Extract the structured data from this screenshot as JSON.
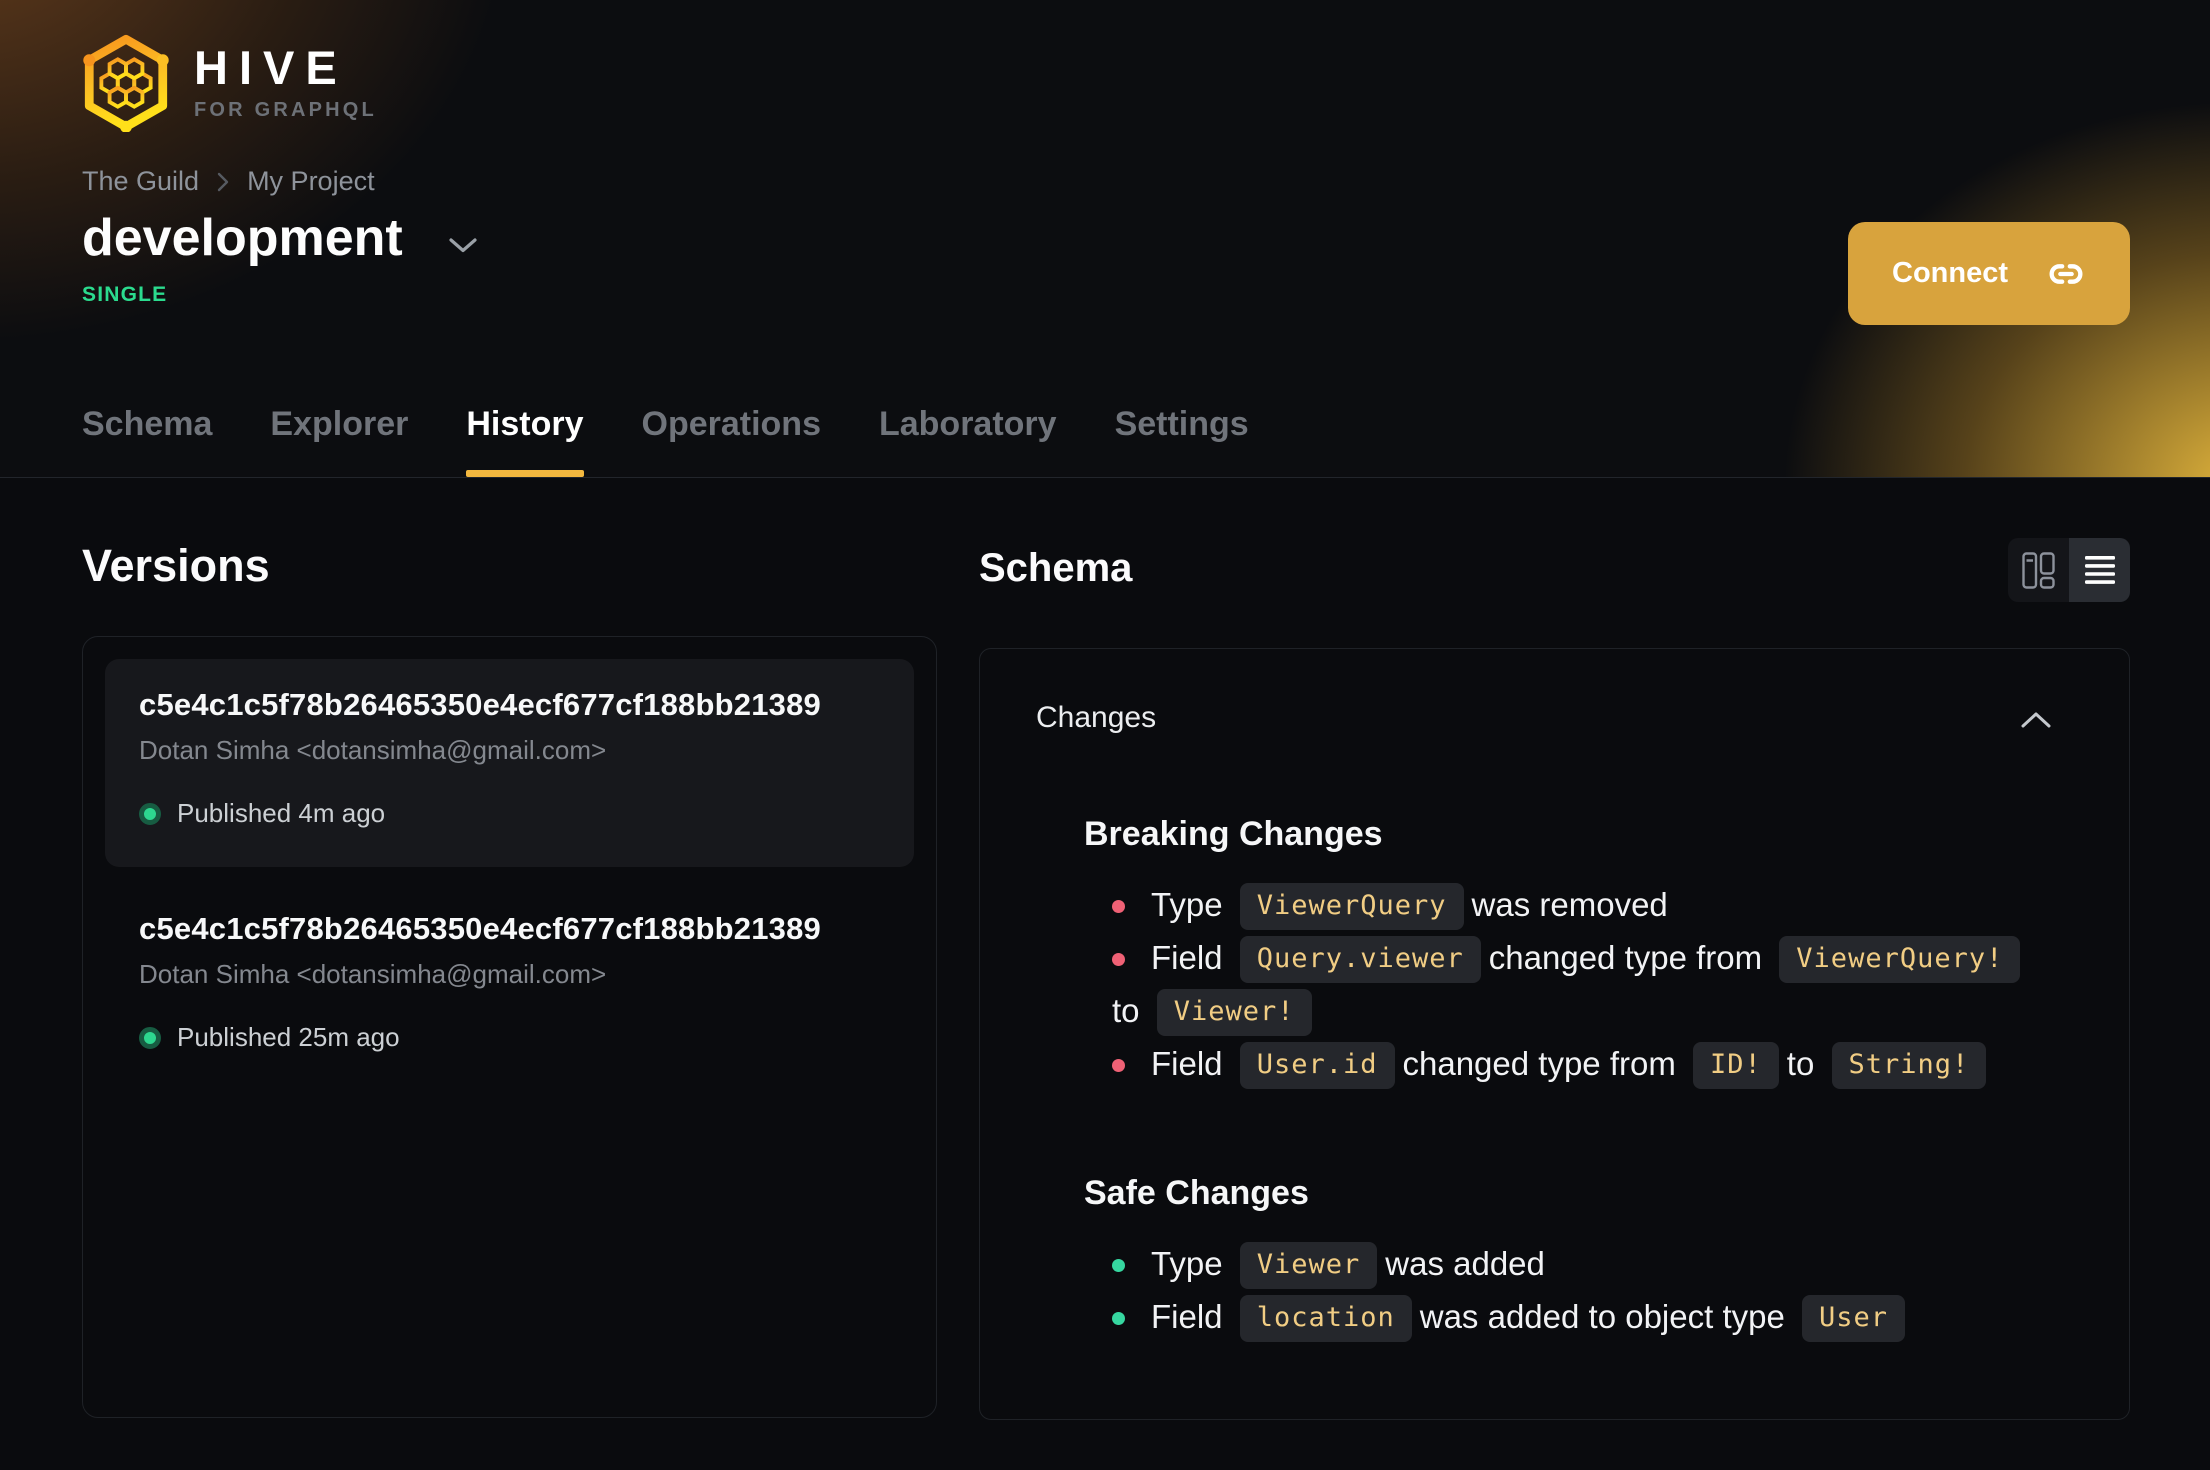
{
  "brand": {
    "name": "HIVE",
    "tagline": "FOR GRAPHQL"
  },
  "breadcrumb": {
    "items": [
      "The Guild",
      "My Project"
    ]
  },
  "target": {
    "title": "development",
    "badge": "SINGLE"
  },
  "connect": {
    "label": "Connect"
  },
  "tabs": [
    {
      "label": "Schema",
      "active": false
    },
    {
      "label": "Explorer",
      "active": false
    },
    {
      "label": "History",
      "active": true
    },
    {
      "label": "Operations",
      "active": false
    },
    {
      "label": "Laboratory",
      "active": false
    },
    {
      "label": "Settings",
      "active": false
    }
  ],
  "versions": {
    "heading": "Versions",
    "items": [
      {
        "hash": "c5e4c1c5f78b26465350e4ecf677cf188bb21389",
        "author": "Dotan Simha <dotansimha@gmail.com>",
        "status": "Published 4m ago",
        "selected": true
      },
      {
        "hash": "c5e4c1c5f78b26465350e4ecf677cf188bb21389",
        "author": "Dotan Simha <dotansimha@gmail.com>",
        "status": "Published 25m ago",
        "selected": false
      }
    ]
  },
  "schema": {
    "heading": "Schema",
    "panel_title": "Changes",
    "view_toggle": {
      "options": [
        "split-view",
        "list-view"
      ],
      "active": "list-view"
    },
    "sections": [
      {
        "title": "Breaking Changes",
        "severity": "breaking",
        "items": [
          {
            "parts": [
              {
                "t": "text",
                "v": "Type"
              },
              {
                "t": "code",
                "v": "ViewerQuery"
              },
              {
                "t": "text",
                "v": "was removed"
              }
            ]
          },
          {
            "parts": [
              {
                "t": "text",
                "v": "Field"
              },
              {
                "t": "code",
                "v": "Query.viewer"
              },
              {
                "t": "text",
                "v": "changed type from"
              },
              {
                "t": "code",
                "v": "ViewerQuery!"
              },
              {
                "t": "break"
              },
              {
                "t": "text",
                "v": "to"
              },
              {
                "t": "code",
                "v": "Viewer!"
              }
            ]
          },
          {
            "parts": [
              {
                "t": "text",
                "v": "Field"
              },
              {
                "t": "code",
                "v": "User.id"
              },
              {
                "t": "text",
                "v": "changed type from"
              },
              {
                "t": "code",
                "v": "ID!"
              },
              {
                "t": "text",
                "v": "to"
              },
              {
                "t": "code",
                "v": "String!"
              }
            ]
          }
        ]
      },
      {
        "title": "Safe Changes",
        "severity": "safe",
        "items": [
          {
            "parts": [
              {
                "t": "text",
                "v": "Type"
              },
              {
                "t": "code",
                "v": "Viewer"
              },
              {
                "t": "text",
                "v": "was added"
              }
            ]
          },
          {
            "parts": [
              {
                "t": "text",
                "v": "Field"
              },
              {
                "t": "code",
                "v": "location"
              },
              {
                "t": "text",
                "v": "was added to object type"
              },
              {
                "t": "code",
                "v": "User"
              }
            ]
          }
        ]
      }
    ]
  },
  "colors": {
    "accent_amber": "#f3b83f",
    "connect_bg": "#d8a33d",
    "badge_green": "#2bdb8e",
    "breaking_red": "#ef6175",
    "safe_green": "#36d7a0",
    "chip_text": "#f1cd84",
    "published_dot": "#2dd78f",
    "published_ring": "#175c42"
  }
}
